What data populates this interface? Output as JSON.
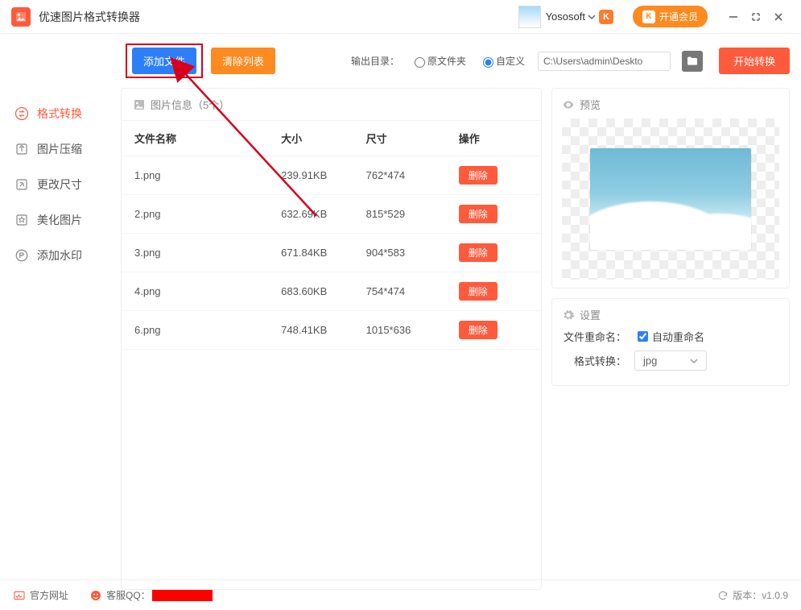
{
  "app": {
    "title": "优速图片格式转换器"
  },
  "user": {
    "name": "Yososoft"
  },
  "titlebar": {
    "vip_label": "开通会员"
  },
  "toolbar": {
    "add_label": "添加文件",
    "clear_label": "清除列表",
    "out_dir_label": "输出目录：",
    "radio_original": "原文件夹",
    "radio_custom": "自定义",
    "path_value": "C:\\Users\\admin\\Deskto",
    "start_label": "开始转换"
  },
  "sidebar": {
    "items": [
      {
        "label": "格式转换"
      },
      {
        "label": "图片压缩"
      },
      {
        "label": "更改尺寸"
      },
      {
        "label": "美化图片"
      },
      {
        "label": "添加水印"
      }
    ]
  },
  "files": {
    "header_label": "图片信息",
    "count_text": "（5个）",
    "col_name": "文件名称",
    "col_size": "大小",
    "col_dim": "尺寸",
    "col_ops": "操作",
    "delete_label": "删除",
    "rows": [
      {
        "name": "1.png",
        "size": "239.91KB",
        "dim": "762*474"
      },
      {
        "name": "2.png",
        "size": "632.69KB",
        "dim": "815*529"
      },
      {
        "name": "3.png",
        "size": "671.84KB",
        "dim": "904*583"
      },
      {
        "name": "4.png",
        "size": "683.60KB",
        "dim": "754*474"
      },
      {
        "name": "6.png",
        "size": "748.41KB",
        "dim": "1015*636"
      }
    ]
  },
  "preview": {
    "title": "预览"
  },
  "settings": {
    "title": "设置",
    "rename_label": "文件重命名：",
    "rename_check": "自动重命名",
    "format_label": "格式转换：",
    "format_value": "jpg"
  },
  "footer": {
    "site_label": "官方网址",
    "qq_label": "客服QQ：",
    "version_label": "版本：",
    "version_value": "v1.0.9"
  }
}
